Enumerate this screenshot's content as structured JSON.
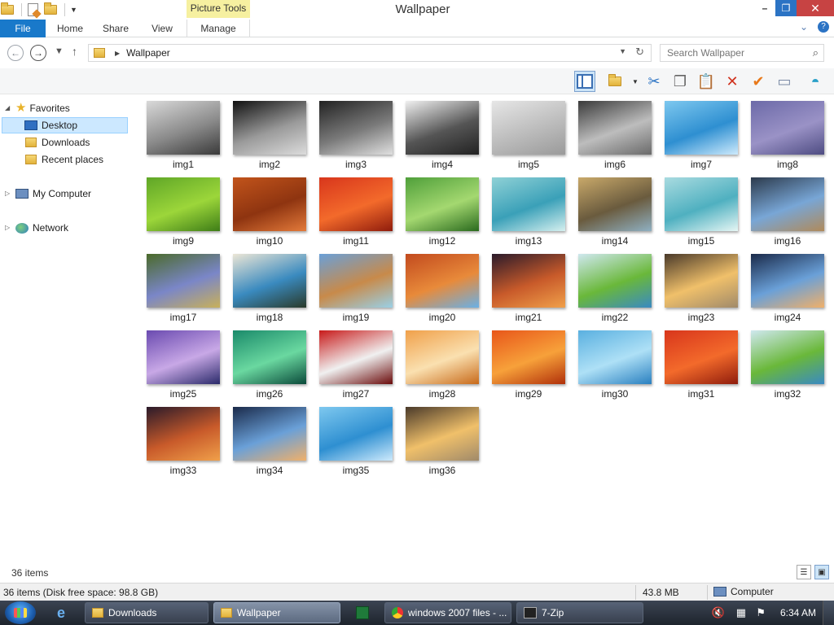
{
  "window": {
    "title": "Wallpaper",
    "contextual_tab_group": "Picture Tools"
  },
  "ribbon": {
    "tabs": [
      {
        "label": "File"
      },
      {
        "label": "Home"
      },
      {
        "label": "Share"
      },
      {
        "label": "View"
      },
      {
        "label": "Manage"
      }
    ]
  },
  "address": {
    "crumb": "Wallpaper",
    "search_placeholder": "Search Wallpaper"
  },
  "nav_pane": {
    "favorites": "Favorites",
    "desktop": "Desktop",
    "downloads": "Downloads",
    "recent": "Recent places",
    "computer": "My Computer",
    "network": "Network"
  },
  "files": [
    {
      "name": "img1",
      "colors": [
        "#d9d9d9",
        "#8a8a8a",
        "#3a3a3a"
      ]
    },
    {
      "name": "img2",
      "colors": [
        "#111111",
        "#9a9a9a",
        "#dcdcdc"
      ]
    },
    {
      "name": "img3",
      "colors": [
        "#222222",
        "#7a7a7a",
        "#e0e0e0"
      ]
    },
    {
      "name": "img4",
      "colors": [
        "#f0f0f0",
        "#555555",
        "#222222"
      ]
    },
    {
      "name": "img5",
      "colors": [
        "#e6e6e6",
        "#bcbcbc",
        "#9a9a9a"
      ]
    },
    {
      "name": "img6",
      "colors": [
        "#3a3a3a",
        "#bdbdbd",
        "#6a6a6a"
      ]
    },
    {
      "name": "img7",
      "colors": [
        "#7ec8ef",
        "#2e8fd1",
        "#cdeafc"
      ]
    },
    {
      "name": "img8",
      "colors": [
        "#6c6aa8",
        "#9a92c6",
        "#4e4c82"
      ]
    },
    {
      "name": "img9",
      "colors": [
        "#5fa627",
        "#9cd63a",
        "#3e7d17"
      ]
    },
    {
      "name": "img10",
      "colors": [
        "#c2541b",
        "#8e3410",
        "#e37a3a"
      ]
    },
    {
      "name": "img11",
      "colors": [
        "#d8361c",
        "#f36a2b",
        "#8f1c0c"
      ]
    },
    {
      "name": "img12",
      "colors": [
        "#4f9f3a",
        "#a4d870",
        "#2a6a1e"
      ]
    },
    {
      "name": "img13",
      "colors": [
        "#8fd1d6",
        "#3aa0b8",
        "#d6f0ef"
      ]
    },
    {
      "name": "img14",
      "colors": [
        "#c9a96a",
        "#6a5b3e",
        "#8fb0c2"
      ]
    },
    {
      "name": "img15",
      "colors": [
        "#a9dbe0",
        "#4fb0c0",
        "#e6f6f4"
      ]
    },
    {
      "name": "img16",
      "colors": [
        "#2c3a4c",
        "#78a6d6",
        "#b08a5a"
      ]
    },
    {
      "name": "img17",
      "colors": [
        "#4a6a2a",
        "#7a86c8",
        "#c8b05a"
      ]
    },
    {
      "name": "img18",
      "colors": [
        "#ece6d6",
        "#3a8abf",
        "#2a3a2a"
      ]
    },
    {
      "name": "img19",
      "colors": [
        "#6aa0d8",
        "#c88a4a",
        "#9ad0e6"
      ]
    },
    {
      "name": "img20",
      "colors": [
        "#c24a1e",
        "#e88a3a",
        "#6ab0e6"
      ]
    },
    {
      "name": "img21",
      "colors": [
        "#2a1a2a",
        "#c85a2a",
        "#f0a04a"
      ]
    },
    {
      "name": "img22",
      "colors": [
        "#cfe8ef",
        "#6ab83a",
        "#3a8ac2"
      ]
    },
    {
      "name": "img23",
      "colors": [
        "#4a3a2a",
        "#f0c06a",
        "#a08a6a"
      ]
    },
    {
      "name": "img24",
      "colors": [
        "#1a2a4a",
        "#6aa0d8",
        "#f0b06a"
      ]
    },
    {
      "name": "img25",
      "colors": [
        "#6a4ab0",
        "#c8a8e6",
        "#2a2a6a"
      ]
    },
    {
      "name": "img26",
      "colors": [
        "#1a8a6a",
        "#6ad8a0",
        "#0a4a3a"
      ]
    },
    {
      "name": "img27",
      "colors": [
        "#c81a1a",
        "#f0f0f0",
        "#6a0a0a"
      ]
    },
    {
      "name": "img28",
      "colors": [
        "#f0a04a",
        "#fae0b0",
        "#c86a1a"
      ]
    },
    {
      "name": "img29",
      "colors": [
        "#e8561a",
        "#f7a13a",
        "#b0300a"
      ]
    },
    {
      "name": "img30",
      "colors": [
        "#5ab0e0",
        "#aee0f6",
        "#2a80c0"
      ]
    },
    {
      "name": "img31",
      "colors": [
        "#d8361c",
        "#f36a2b",
        "#8f1c0c"
      ]
    },
    {
      "name": "img32",
      "colors": [
        "#cfe8ef",
        "#6ab83a",
        "#3a8ac2"
      ]
    },
    {
      "name": "img33",
      "colors": [
        "#2a1a2a",
        "#c85a2a",
        "#f0a04a"
      ]
    },
    {
      "name": "img34",
      "colors": [
        "#1a2a4a",
        "#6aa0d8",
        "#f0b06a"
      ]
    },
    {
      "name": "img35",
      "colors": [
        "#7ec8ef",
        "#2e8fd1",
        "#cdeafc"
      ]
    },
    {
      "name": "img36",
      "colors": [
        "#4a3a2a",
        "#f0c06a",
        "#a08a6a"
      ]
    }
  ],
  "status": {
    "item_count": "36 items",
    "detail": "36 items (Disk free space: 98.8 GB)",
    "size": "43.8 MB",
    "location": "Computer"
  },
  "taskbar": {
    "items": [
      {
        "label": "Downloads"
      },
      {
        "label": "Wallpaper"
      },
      {
        "label": "windows 2007 files - ..."
      },
      {
        "label": "7-Zip"
      }
    ],
    "clock": "6:34 AM"
  },
  "colors": {
    "accent": "#1979ca",
    "selection": "#cce8ff",
    "close": "#c74343"
  }
}
